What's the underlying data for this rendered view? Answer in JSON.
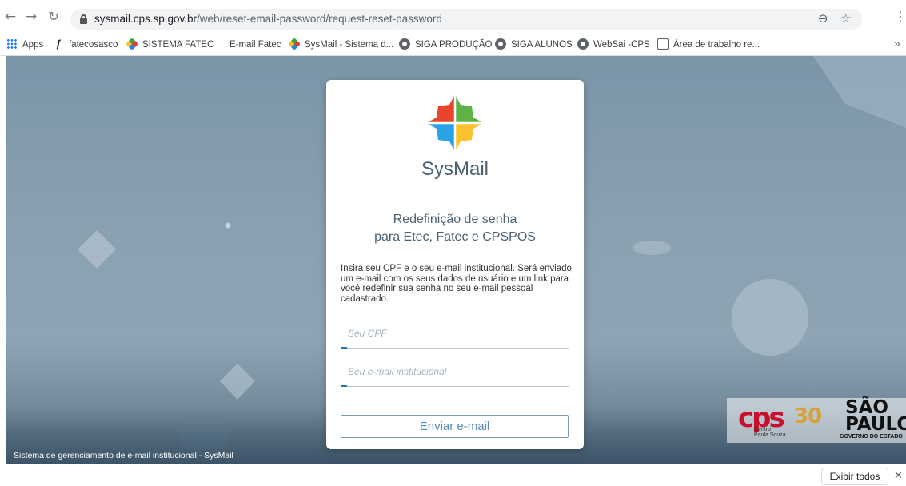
{
  "browser": {
    "url_host": "sysmail.cps.sp.gov.br",
    "url_path": "/web/reset-email-password/request-reset-password",
    "icons": {
      "back": "arrow-left-icon",
      "forward": "arrow-right-icon",
      "reload": "reload-icon",
      "lock": "lock-icon",
      "zoom": "zoom-out-icon",
      "star": "star-icon",
      "menu": "kebab-menu-icon"
    },
    "bookmarks": [
      {
        "label": "Apps",
        "icon": "apps-grid-icon"
      },
      {
        "label": "fatecosasco",
        "icon": "fatec-icon"
      },
      {
        "label": "SISTEMA FATEC",
        "icon": "sysmail-icon"
      },
      {
        "label": "E-mail Fatec",
        "icon": "microsoft-icon"
      },
      {
        "label": "SysMail - Sistema d...",
        "icon": "sysmail-icon"
      },
      {
        "label": "SIGA PRODUÇÃO",
        "icon": "globe-icon"
      },
      {
        "label": "SIGA ALUNOS",
        "icon": "globe-icon"
      },
      {
        "label": "WebSai -CPS",
        "icon": "globe-icon"
      },
      {
        "label": "Área de trabalho re...",
        "icon": "remote-desktop-icon"
      }
    ],
    "bookmarks_more": "»"
  },
  "page": {
    "brand": "SysMail",
    "heading_line1": "Redefinição de senha",
    "heading_line2": "para Etec, Fatec e CPSPOS",
    "description": "Insira seu CPF e o seu e-mail institucional. Será enviado um e-mail com os seus dados de usuário e um link para você redefinir sua senha no seu e-mail pessoal cadastrado.",
    "cpf_placeholder": "Seu CPF",
    "email_placeholder": "Seu e-mail institucional",
    "submit_label": "Enviar e-mail",
    "footer": "Sistema de gerenciamento de e-mail institucional - SysMail",
    "logos": {
      "cps_30": "30",
      "cps_name_line1": "Centro",
      "cps_name_line2": "Paula Souza",
      "sp_line1": "SÃO",
      "sp_line2": "PAULO",
      "sp_gov": "GOVERNO DO ESTADO"
    },
    "colors": {
      "logo_red": "#e8452c",
      "logo_blue": "#2aa3e6",
      "logo_yellow": "#fbc22f",
      "logo_green": "#5fb346",
      "accent": "#2f6fb8"
    }
  },
  "downloads": {
    "show_all_label": "Exibir todos",
    "close_icon": "close-icon"
  }
}
